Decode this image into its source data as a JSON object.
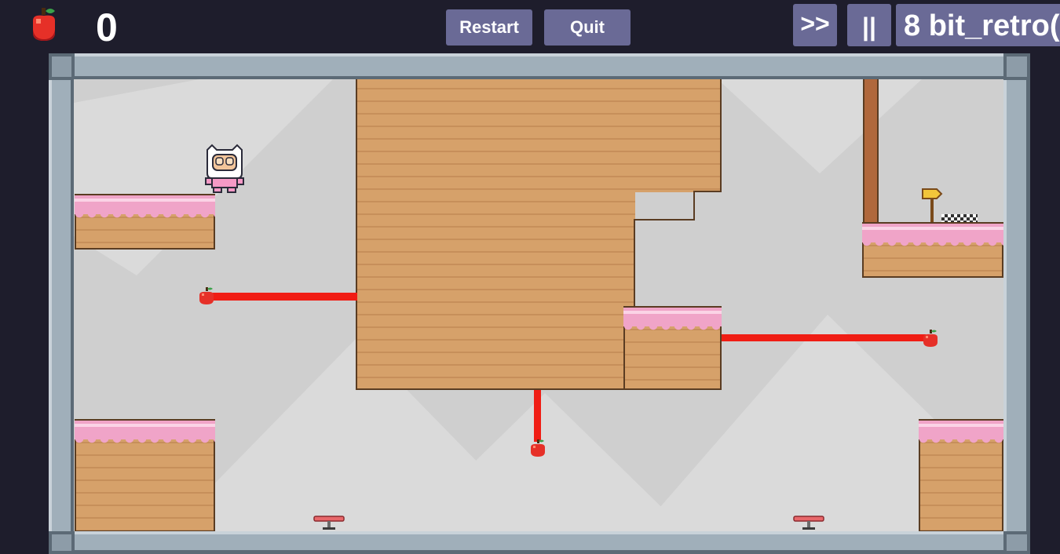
{
  "hud": {
    "score_icon": "apple-icon",
    "score": "0",
    "restart_label": "Restart",
    "quit_label": "Quit",
    "fast_forward_label": ">>",
    "pause_label": "||",
    "music_track_label": "8 bit_retro("
  },
  "level": {
    "player": "pink-astronaut-character",
    "collectibles": [
      "apple",
      "apple",
      "apple"
    ],
    "hazards": [
      "red-laser-beam",
      "red-laser-beam",
      "red-laser-beam"
    ],
    "bouncers": [
      "trampoline",
      "trampoline"
    ],
    "goal": "checkered-finish-with-arrow-sign"
  },
  "colors": {
    "background": "#1e1d2c",
    "button": "#6a6a96",
    "frame": "#a0afba",
    "field": "#cfcfcf",
    "dirt": "#d6a16a",
    "frosting": "#f0a4c8",
    "laser": "#f01d14"
  }
}
